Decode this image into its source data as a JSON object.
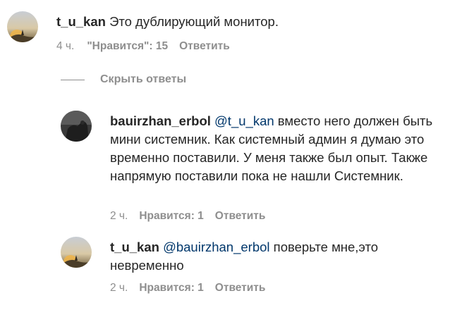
{
  "comments": [
    {
      "username": "t_u_kan",
      "mention": "",
      "text": "Это дублирующий монитор.",
      "time": "4 ч.",
      "likes": "\"Нравится\": 15",
      "reply": "Ответить"
    }
  ],
  "hide_replies": "Скрыть ответы",
  "replies": [
    {
      "username": "bauirzhan_erbol",
      "mention": "@t_u_kan",
      "text": "вместо него должен быть мини системник. Как системный админ я думаю это временно поставили. У меня также был опыт. Также напрямую поставили пока не нашли Системник.",
      "time": "2 ч.",
      "likes": "Нравится: 1",
      "reply": "Ответить"
    },
    {
      "username": "t_u_kan",
      "mention": "@bauirzhan_erbol",
      "text": "поверьте мне,это невременно",
      "time": "2 ч.",
      "likes": "Нравится: 1",
      "reply": "Ответить"
    }
  ]
}
